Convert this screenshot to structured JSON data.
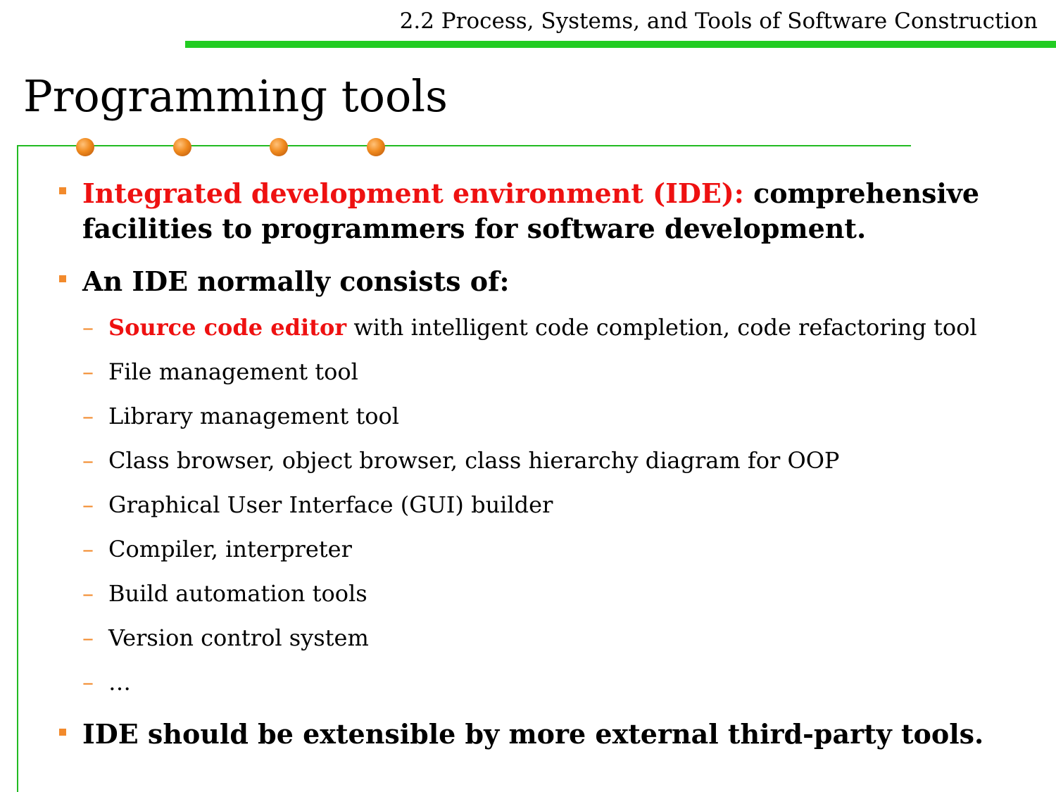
{
  "header": {
    "section_title": "2.2 Process, Systems, and Tools of Software Construction"
  },
  "slide": {
    "title": "Programming tools"
  },
  "bullets": [
    {
      "highlight": "Integrated development environment (IDE):",
      "text_line1": "comprehensive",
      "text_line2": "facilities to programmers for software development."
    },
    {
      "text": "An IDE normally consists of:"
    },
    {
      "text": "IDE should be extensible by more external third-party tools."
    }
  ],
  "sub_items": [
    {
      "highlight": "Source code editor",
      "text": " with intelligent code completion, code refactoring tool"
    },
    {
      "text": "File management tool"
    },
    {
      "text": "Library management tool"
    },
    {
      "text": "Class browser, object browser, class hierarchy diagram for OOP"
    },
    {
      "text": "Graphical User Interface (GUI) builder"
    },
    {
      "text": "Compiler, interpreter"
    },
    {
      "text": "Build automation tools"
    },
    {
      "text": "Version control system"
    },
    {
      "text": "…"
    }
  ],
  "colors": {
    "accent_green": "#22cc22",
    "highlight_red": "#ee1111",
    "bullet_orange": "#f28a2c"
  }
}
